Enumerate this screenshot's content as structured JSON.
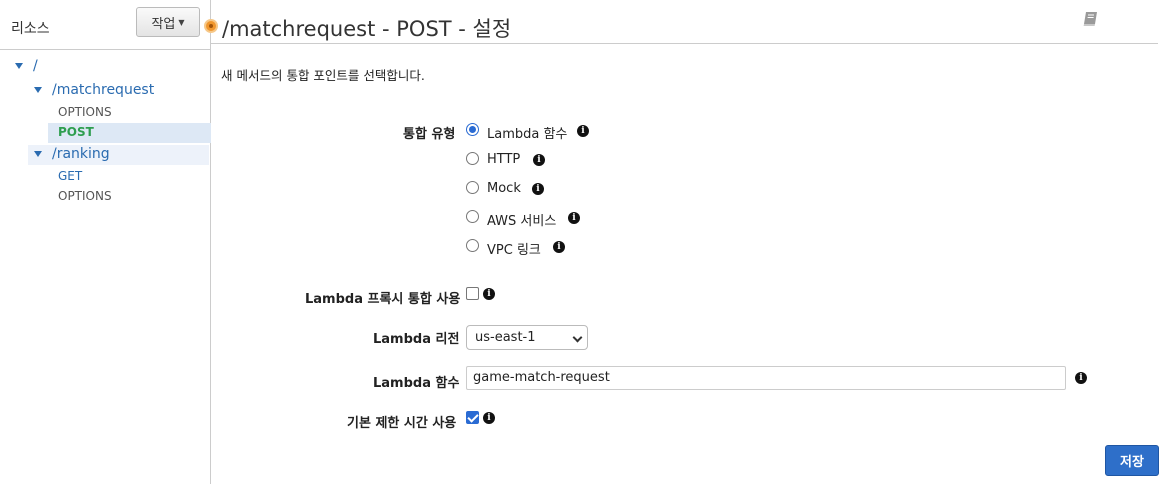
{
  "sidebar": {
    "title": "리소스",
    "actions_label": "작업",
    "tree": {
      "root": "/",
      "matchrequest": {
        "path": "/matchrequest",
        "methods": [
          "OPTIONS",
          "POST"
        ]
      },
      "ranking": {
        "path": "/ranking",
        "methods": [
          "GET",
          "OPTIONS"
        ]
      }
    }
  },
  "header": {
    "title": "/matchrequest - POST - 설정"
  },
  "main": {
    "subtitle": "새 메서드의 통합 포인트를 선택합니다.",
    "integration_type": {
      "label": "통합 유형",
      "options": [
        "Lambda 함수",
        "HTTP",
        "Mock",
        "AWS 서비스",
        "VPC 링크"
      ],
      "selected": "Lambda 함수"
    },
    "proxy": {
      "label": "Lambda 프록시 통합 사용",
      "checked": false
    },
    "region": {
      "label": "Lambda 리전",
      "value": "us-east-1"
    },
    "function": {
      "label": "Lambda 함수",
      "value": "game-match-request"
    },
    "timeout": {
      "label": "기본 제한 시간 사용",
      "checked": true
    },
    "save_label": "저장"
  },
  "colors": {
    "accent": "#2a6bd3",
    "link": "#2a6bb0",
    "selected_method": "#2e9e4f",
    "recording_dot": "#f0962d"
  }
}
